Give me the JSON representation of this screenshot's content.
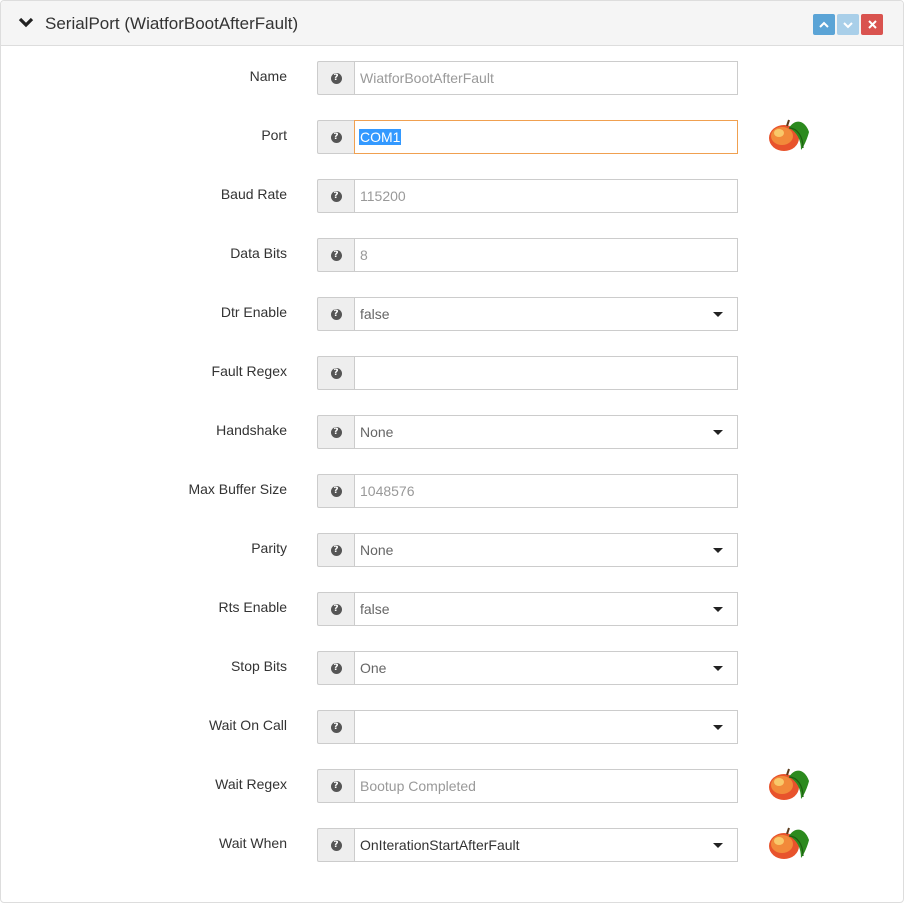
{
  "header": {
    "title": "SerialPort (WiatforBootAfterFault)"
  },
  "icons": {
    "collapse": "chevron-down-icon",
    "move_up": "chevron-up-icon",
    "move_down": "chevron-down-icon",
    "remove": "close-icon",
    "help": "question-circle-icon",
    "peach": "peach-icon"
  },
  "colors": {
    "move_up_button": "#5ba4d6",
    "move_down_button": "#a9cfe9",
    "remove_button": "#d9534f",
    "focus_border": "#f0a050",
    "selection": "#3399ff"
  },
  "fields": {
    "name": {
      "label": "Name",
      "value": "WiatforBootAfterFault"
    },
    "port": {
      "label": "Port",
      "value": "COM1"
    },
    "baud_rate": {
      "label": "Baud Rate",
      "value": "115200"
    },
    "data_bits": {
      "label": "Data Bits",
      "value": "8"
    },
    "dtr_enable": {
      "label": "Dtr Enable",
      "value": "false"
    },
    "fault_regex": {
      "label": "Fault Regex",
      "value": ""
    },
    "handshake": {
      "label": "Handshake",
      "value": "None"
    },
    "max_buffer_size": {
      "label": "Max Buffer Size",
      "value": "1048576"
    },
    "parity": {
      "label": "Parity",
      "value": "None"
    },
    "rts_enable": {
      "label": "Rts Enable",
      "value": "false"
    },
    "stop_bits": {
      "label": "Stop Bits",
      "value": "One"
    },
    "wait_on_call": {
      "label": "Wait On Call",
      "value": ""
    },
    "wait_regex": {
      "label": "Wait Regex",
      "value": "Bootup Completed"
    },
    "wait_when": {
      "label": "Wait When",
      "value": "OnIterationStartAfterFault"
    }
  }
}
